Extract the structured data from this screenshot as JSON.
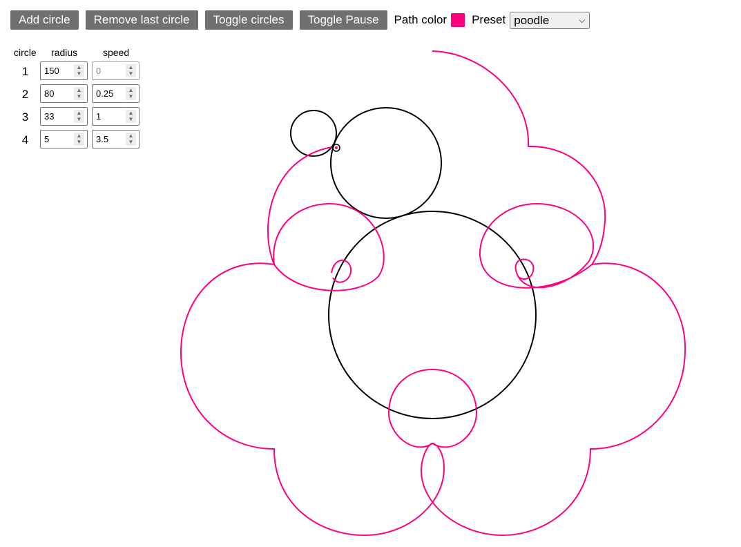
{
  "toolbar": {
    "add_circle": "Add circle",
    "remove_last": "Remove last circle",
    "toggle_circles": "Toggle circles",
    "toggle_pause": "Toggle Pause",
    "path_color_label": "Path color",
    "path_color": "#ff0080",
    "preset_label": "Preset",
    "preset_value": "poodle"
  },
  "table": {
    "headers": {
      "circle": "circle",
      "radius": "radius",
      "speed": "speed"
    },
    "rows": [
      {
        "num": "1",
        "radius": "150",
        "speed": "0",
        "speed_disabled": true
      },
      {
        "num": "2",
        "radius": "80",
        "speed": "0.25",
        "speed_disabled": false
      },
      {
        "num": "3",
        "radius": "33",
        "speed": "1",
        "speed_disabled": false
      },
      {
        "num": "4",
        "radius": "5",
        "speed": "3.5",
        "speed_disabled": false
      }
    ]
  },
  "colors": {
    "path": "#ff0080",
    "circles": "#000000",
    "button_bg": "#707070"
  },
  "icons": {
    "spinner": "spinner-arrows-icon",
    "select_chevron": "chevron-down-icon"
  }
}
